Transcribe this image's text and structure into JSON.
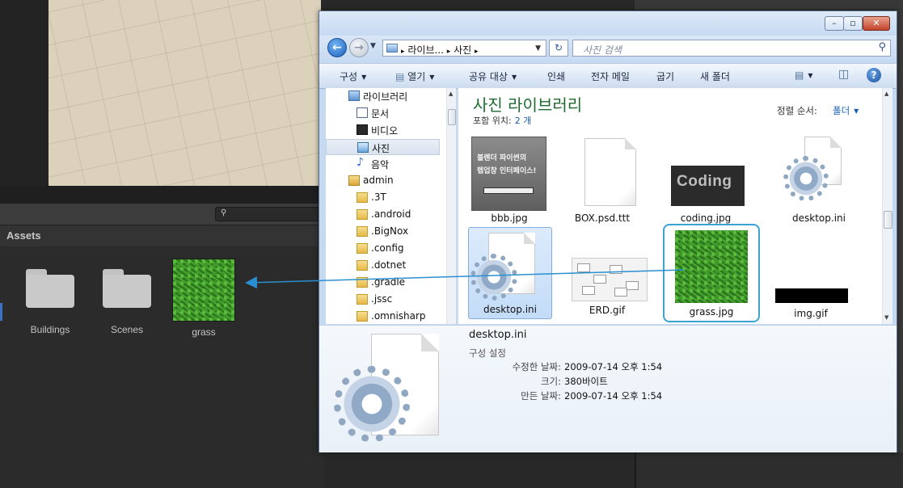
{
  "unity": {
    "assets_header": "Assets",
    "assets": [
      {
        "label": "Buildings",
        "kind": "folder"
      },
      {
        "label": "Scenes",
        "kind": "folder"
      },
      {
        "label": "grass",
        "kind": "texture"
      }
    ]
  },
  "explorer": {
    "breadcrumb": {
      "part1": "라이브...",
      "sep": "▸",
      "part2": "사진"
    },
    "search_placeholder": "사진 검색",
    "commands": {
      "organize": "구성",
      "open": "열기",
      "share": "공유 대상",
      "print": "인쇄",
      "email": "전자 메일",
      "burn": "굽기",
      "new_folder": "새 폴더"
    },
    "nav_tree": [
      {
        "label": "라이브러리",
        "icon": "library-icon"
      },
      {
        "label": "문서",
        "icon": "document-icon"
      },
      {
        "label": "비디오",
        "icon": "video-icon"
      },
      {
        "label": "사진",
        "icon": "pictures-icon"
      },
      {
        "label": "음악",
        "icon": "music-icon"
      },
      {
        "label": "admin",
        "icon": "user-folder-icon"
      },
      {
        "label": ".3T",
        "icon": "folder-icon"
      },
      {
        "label": ".android",
        "icon": "folder-icon"
      },
      {
        "label": ".BigNox",
        "icon": "folder-icon"
      },
      {
        "label": ".config",
        "icon": "folder-icon"
      },
      {
        "label": ".dotnet",
        "icon": "folder-icon"
      },
      {
        "label": ".gradle",
        "icon": "folder-icon"
      },
      {
        "label": ".jssc",
        "icon": "folder-icon"
      },
      {
        "label": ".omnisharp",
        "icon": "folder-icon"
      }
    ],
    "library": {
      "title": "사진 라이브러리",
      "includes_label": "포함 위치:",
      "includes_value": "2 개",
      "sort_label": "정렬 순서:",
      "sort_value": "폴더"
    },
    "files": [
      {
        "name": "bbb.jpg",
        "thumb_text": "블렌더 파이썬의\n렙업창 인터페이스!"
      },
      {
        "name": "BOX.psd.ttt"
      },
      {
        "name": "coding.jpg",
        "thumb_text": "Coding"
      },
      {
        "name": "desktop.ini"
      },
      {
        "name": "desktop.ini"
      },
      {
        "name": "ERD.gif"
      },
      {
        "name": "grass.jpg"
      },
      {
        "name": "img.gif"
      }
    ],
    "details": {
      "name": "desktop.ini",
      "type": "구성 설정",
      "modified_label": "수정한 날짜:",
      "modified_value": "2009-07-14 오후 1:54",
      "size_label": "크기:",
      "size_value": "380바이트",
      "created_label": "만든 날짜:",
      "created_value": "2009-07-14 오후 1:54"
    }
  },
  "colors": {
    "library_title": "#1e6b2f",
    "drag_arrow": "#2a8fd0",
    "grass_selection": "#3aa3d4"
  }
}
